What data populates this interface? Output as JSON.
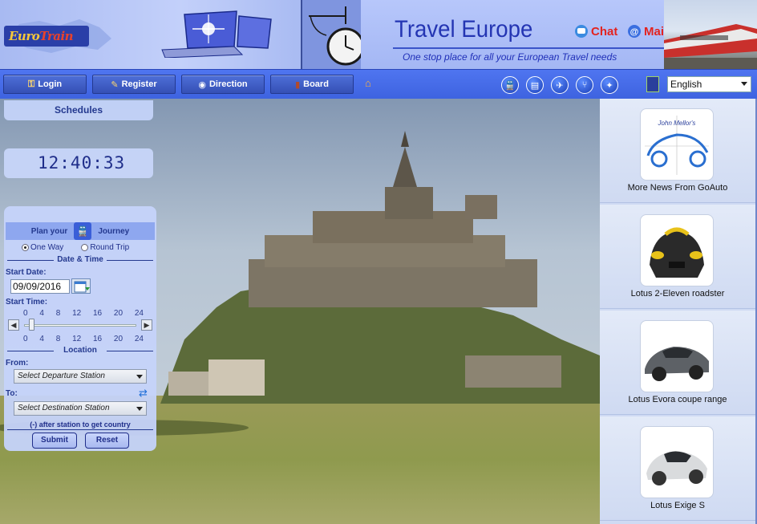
{
  "header": {
    "logo_main": "Euro",
    "logo_accent": "Train",
    "title": "Travel Europe",
    "tagline": "One stop place for all your European Travel needs",
    "chat_label": "Chat",
    "mail_label": "Mail"
  },
  "nav": {
    "items": [
      {
        "label": "Login",
        "icon": "key-icon"
      },
      {
        "label": "Register",
        "icon": "pencil-icon"
      },
      {
        "label": "Direction",
        "icon": "compass-icon"
      },
      {
        "label": "Board",
        "icon": "board-icon"
      }
    ],
    "language_selected": "English"
  },
  "left": {
    "schedules_label": "Schedules",
    "clock_time": "12:40:33"
  },
  "planner": {
    "head_left": "Plan your",
    "head_right": "Journey",
    "one_way": "One Way",
    "round_trip": "Round Trip",
    "date_time_title": "Date & Time",
    "start_date_label": "Start Date:",
    "start_date_value": "09/09/2016",
    "start_time_label": "Start Time:",
    "ticks": [
      "0",
      "4",
      "8",
      "12",
      "16",
      "20",
      "24"
    ],
    "location_title": "Location",
    "from_label": "From:",
    "from_placeholder": "Select Departure Station",
    "to_label": "To:",
    "to_placeholder": "Select Destination Station",
    "note": "(-) after station to get country",
    "submit": "Submit",
    "reset": "Reset"
  },
  "ads": [
    {
      "caption": "More News From GoAuto",
      "logo_text": "John Mellor's"
    },
    {
      "caption": "Lotus 2-Eleven roadster"
    },
    {
      "caption": "Lotus Evora coupe range"
    },
    {
      "caption": "Lotus Exige S"
    }
  ]
}
